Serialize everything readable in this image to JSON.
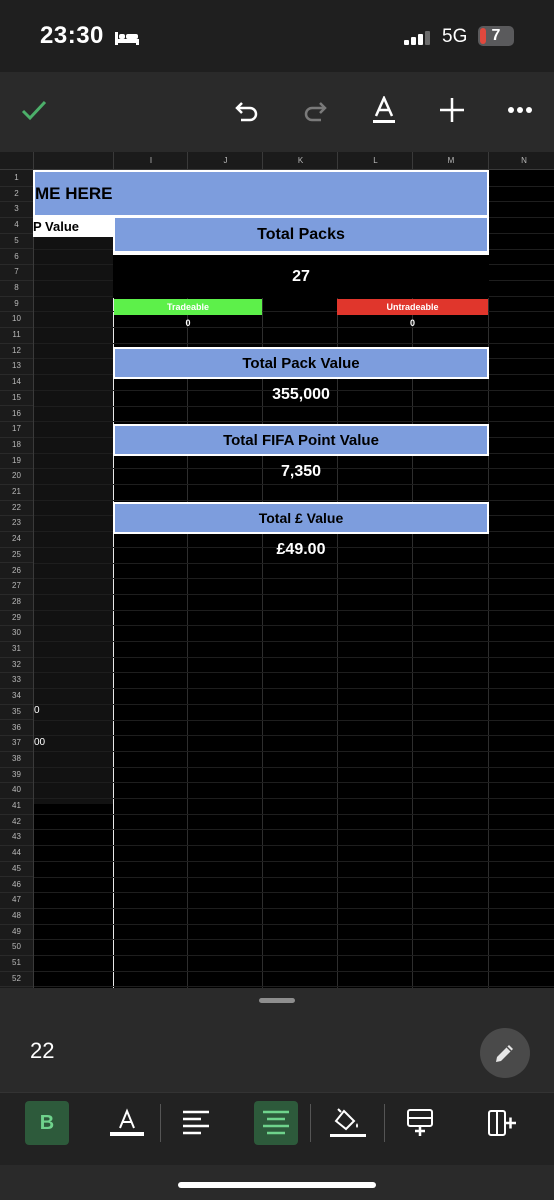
{
  "status_bar": {
    "time": "23:30",
    "network": "5G",
    "battery": "7"
  },
  "toolbar": {
    "icons": [
      "check-icon",
      "undo-icon",
      "redo-icon",
      "text-format-icon",
      "add-icon",
      "more-icon"
    ]
  },
  "sheet": {
    "column_headers": [
      "I",
      "J",
      "K",
      "L",
      "M",
      "N"
    ],
    "row_numbers": [
      "1",
      "2",
      "3",
      "4",
      "5",
      "6",
      "7",
      "8",
      "9",
      "10",
      "11",
      "12",
      "13",
      "14",
      "15",
      "16",
      "17",
      "18",
      "19",
      "20",
      "21",
      "22",
      "23",
      "24",
      "25",
      "26",
      "27",
      "28",
      "29",
      "30",
      "31",
      "32",
      "33",
      "34",
      "35",
      "36",
      "37",
      "38",
      "39",
      "40",
      "41",
      "42",
      "43",
      "44",
      "45",
      "46",
      "47",
      "48",
      "49",
      "50",
      "51",
      "52"
    ],
    "name_banner": "ME HERE",
    "left_header": "P Value",
    "left_cells": {
      "row35": "0",
      "row37": "00"
    },
    "total_packs_label": "Total Packs",
    "total_packs_value": "27",
    "tradeable_label": "Tradeable",
    "tradeable_value": "0",
    "untradeable_label": "Untradeable",
    "untradeable_value": "0",
    "pack_value_label": "Total Pack Value",
    "pack_value": "355,000",
    "fifa_points_label": "Total FIFA Point Value",
    "fifa_points_value": "7,350",
    "gbp_label": "Total £ Value",
    "gbp_value": "£49.00"
  },
  "cell_editor": {
    "value": "22"
  },
  "format_bar": {
    "bold_label": "B",
    "icons": [
      "bold-icon",
      "text-color-icon",
      "align-left-icon",
      "align-center-icon",
      "fill-color-icon",
      "insert-row-icon",
      "insert-column-icon"
    ]
  },
  "colors": {
    "header_blue": "#7d9ddd",
    "tradeable_green": "#5df04a",
    "untradeable_red": "#e0362c",
    "accent_green": "#4caf6a"
  }
}
